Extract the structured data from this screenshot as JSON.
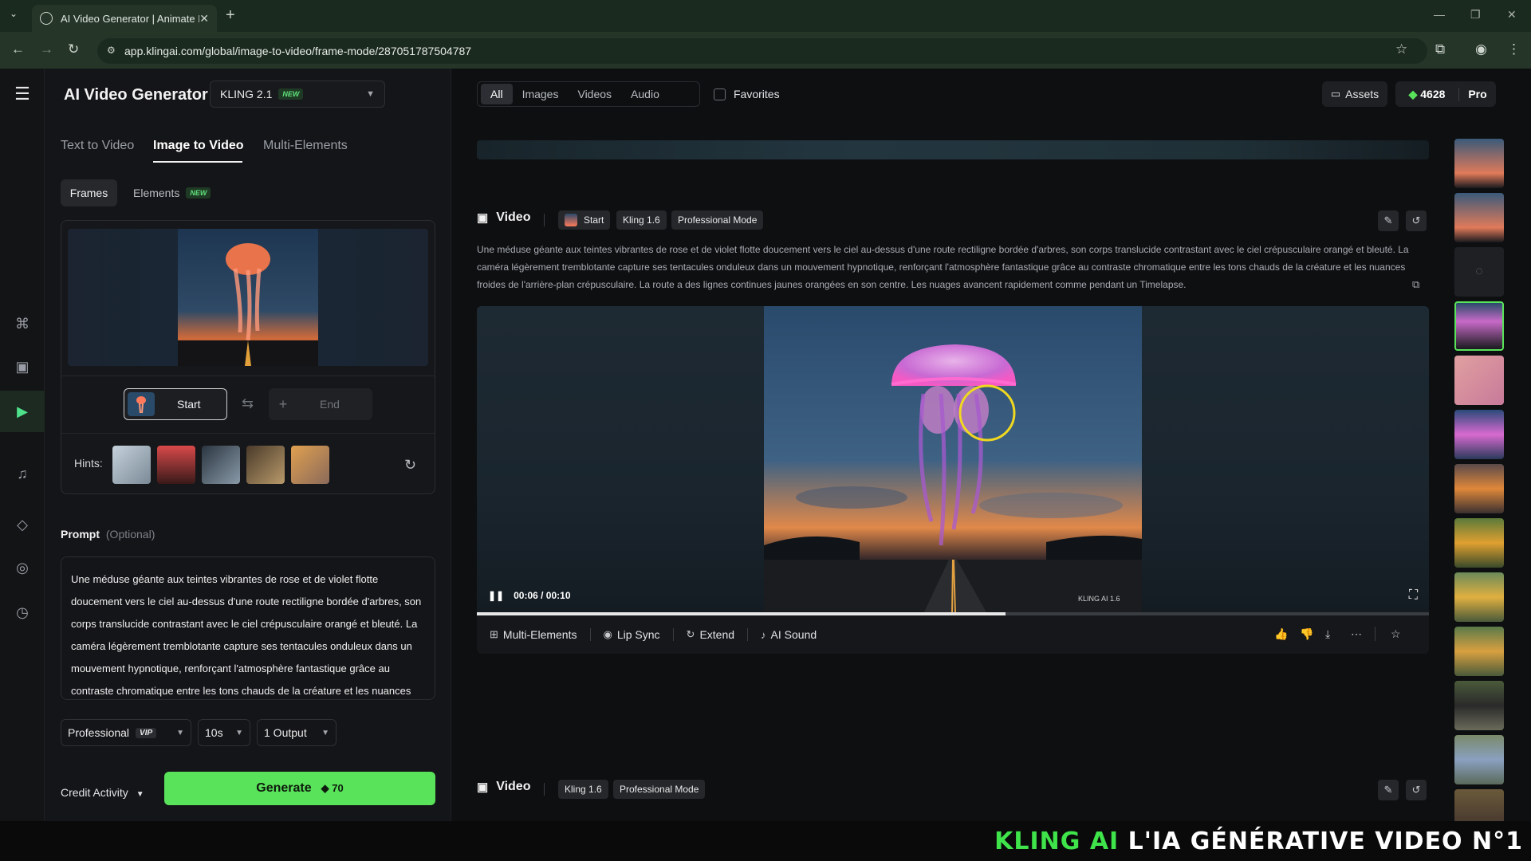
{
  "browser": {
    "tab_title": "AI Video Generator | Animate P",
    "url": "app.klingai.com/global/image-to-video/frame-mode/287051787504787"
  },
  "header": {
    "app_title": "AI Video Generator",
    "model": "KLING 2.1",
    "model_badge": "NEW"
  },
  "mode_tabs": [
    "Text to Video",
    "Image to Video",
    "Multi-Elements"
  ],
  "active_mode": "Image to Video",
  "subtabs": {
    "frames": "Frames",
    "elements": "Elements",
    "elements_badge": "NEW"
  },
  "frame_controls": {
    "start": "Start",
    "end": "End",
    "hints_label": "Hints:"
  },
  "prompt": {
    "label": "Prompt",
    "optional": "(Optional)",
    "text": "Une méduse géante aux teintes vibrantes de rose et de violet flotte doucement vers le ciel au-dessus d'une route rectiligne bordée d'arbres, son corps translucide contrastant avec le ciel crépusculaire orangé et bleuté. La caméra légèrement tremblotante capture ses tentacules onduleux dans un mouvement hypnotique, renforçant l'atmosphère fantastique grâce au contraste chromatique entre les tons chauds de la créature et les nuances"
  },
  "settings": {
    "mode": "Professional",
    "mode_badge": "VIP",
    "duration": "10s",
    "outputs": "1 Output"
  },
  "footer": {
    "credit_activity": "Credit Activity",
    "generate": "Generate",
    "cost": "70"
  },
  "filters": {
    "tabs": [
      "All",
      "Images",
      "Videos",
      "Audio"
    ],
    "active": "All",
    "favorites": "Favorites"
  },
  "account": {
    "assets": "Assets",
    "credits": "4628",
    "plan": "Pro"
  },
  "video1": {
    "title": "Video",
    "chip_start": "Start",
    "chip_model": "Kling 1.6",
    "chip_mode": "Professional Mode",
    "description": "Une méduse géante aux teintes vibrantes de rose et de violet flotte doucement vers le ciel au-dessus d'une route rectiligne bordée d'arbres, son corps translucide contrastant avec le ciel crépusculaire orangé et bleuté. La caméra légèrement tremblotante capture ses tentacules onduleux dans un mouvement hypnotique, renforçant l'atmosphère fantastique grâce au contraste chromatique entre les tons chauds de la créature et les nuances froides de l'arrière-plan crépusculaire. La route a des lignes continues jaunes orangées en son centre. Les nuages avancent rapidement comme pendant un Timelapse.",
    "timecode": "00:06 / 00:10",
    "progress": 0.555,
    "watermark": "KLING AI 1.6",
    "actions": [
      "Multi-Elements",
      "Lip Sync",
      "Extend",
      "AI Sound"
    ]
  },
  "video2": {
    "title": "Video",
    "chip_model": "Kling 1.6",
    "chip_mode": "Professional Mode"
  },
  "banner": {
    "accent": "KLING AI",
    "text": "L'IA GÉNÉRATIVE VIDEO N°1"
  },
  "colors": {
    "accent_green": "#59e35a",
    "banner_green": "#3fe34a"
  }
}
